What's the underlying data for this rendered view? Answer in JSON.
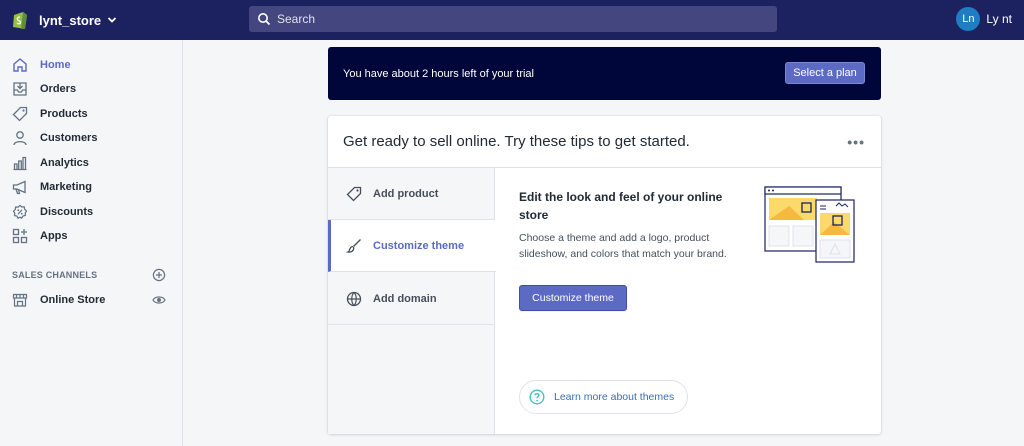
{
  "topbar": {
    "store_name": "lynt_store",
    "search_placeholder": "Search",
    "user_initials": "Ln",
    "user_name": "Ly nt"
  },
  "sidebar": {
    "items": [
      {
        "label": "Home",
        "icon": "home-icon",
        "active": true
      },
      {
        "label": "Orders",
        "icon": "orders-icon"
      },
      {
        "label": "Products",
        "icon": "tag-icon"
      },
      {
        "label": "Customers",
        "icon": "person-icon"
      },
      {
        "label": "Analytics",
        "icon": "bar-chart-icon"
      },
      {
        "label": "Marketing",
        "icon": "megaphone-icon"
      },
      {
        "label": "Discounts",
        "icon": "discount-icon"
      },
      {
        "label": "Apps",
        "icon": "apps-icon"
      }
    ],
    "sales_channels_title": "SALES CHANNELS",
    "online_store_label": "Online Store"
  },
  "trial": {
    "text": "You have about 2 hours left of your trial",
    "button": "Select a plan"
  },
  "card": {
    "title": "Get ready to sell online. Try these tips to get started.",
    "more": "•••",
    "tabs": [
      {
        "label": "Add product",
        "icon": "tag-icon"
      },
      {
        "label": "Customize theme",
        "icon": "paintbrush-icon",
        "active": true
      },
      {
        "label": "Add domain",
        "icon": "globe-icon"
      }
    ],
    "panel_title": "Edit the look and feel of your online store",
    "panel_desc": "Choose a theme and add a logo, product slideshow, and colors that match your brand.",
    "cta": "Customize theme",
    "learn_more": "Learn more about themes"
  },
  "colors": {
    "topbar": "#1c2260",
    "accent": "#5c6ac4",
    "trial_bg": "#000639"
  }
}
